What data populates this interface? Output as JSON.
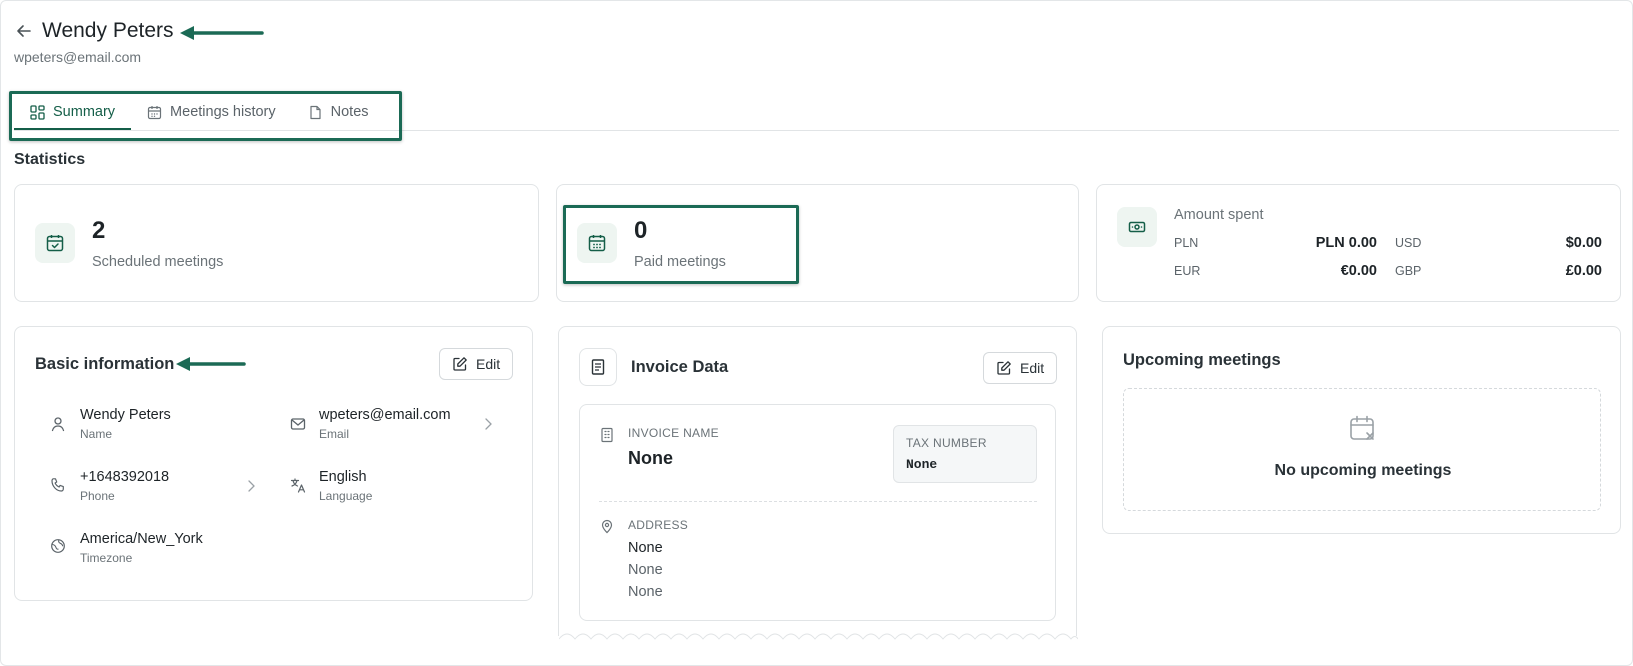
{
  "header": {
    "back_icon": "arrow-left-icon",
    "name": "Wendy Peters",
    "email": "wpeters@email.com"
  },
  "tabs": [
    {
      "label": "Summary",
      "icon": "grid-icon",
      "active": true
    },
    {
      "label": "Meetings history",
      "icon": "calendar-icon",
      "active": false
    },
    {
      "label": "Notes",
      "icon": "note-icon",
      "active": false
    }
  ],
  "statistics": {
    "title": "Statistics",
    "scheduled": {
      "value": "2",
      "label": "Scheduled meetings"
    },
    "paid": {
      "value": "0",
      "label": "Paid meetings"
    },
    "amount": {
      "title": "Amount spent",
      "rows": [
        {
          "currency": "PLN",
          "value": "PLN 0.00"
        },
        {
          "currency": "USD",
          "value": "$0.00"
        },
        {
          "currency": "EUR",
          "value": "€0.00"
        },
        {
          "currency": "GBP",
          "value": "£0.00"
        }
      ]
    }
  },
  "basic_info": {
    "title": "Basic information",
    "edit_label": "Edit",
    "name": {
      "value": "Wendy Peters",
      "label": "Name"
    },
    "email": {
      "value": "wpeters@email.com",
      "label": "Email"
    },
    "phone": {
      "value": "+1648392018",
      "label": "Phone"
    },
    "language": {
      "value": "English",
      "label": "Language"
    },
    "timezone": {
      "value": "America/New_York",
      "label": "Timezone"
    }
  },
  "invoice": {
    "title": "Invoice Data",
    "edit_label": "Edit",
    "invoice_name_label": "INVOICE NAME",
    "invoice_name_value": "None",
    "tax_label": "TAX NUMBER",
    "tax_value": "None",
    "address_label": "ADDRESS",
    "address_lines": [
      "None",
      "None",
      "None"
    ]
  },
  "upcoming": {
    "title": "Upcoming meetings",
    "empty_text": "No upcoming meetings"
  },
  "colors": {
    "accent": "#145e48",
    "highlight": "#1b6a55",
    "icon_bg": "#eef5f1"
  }
}
